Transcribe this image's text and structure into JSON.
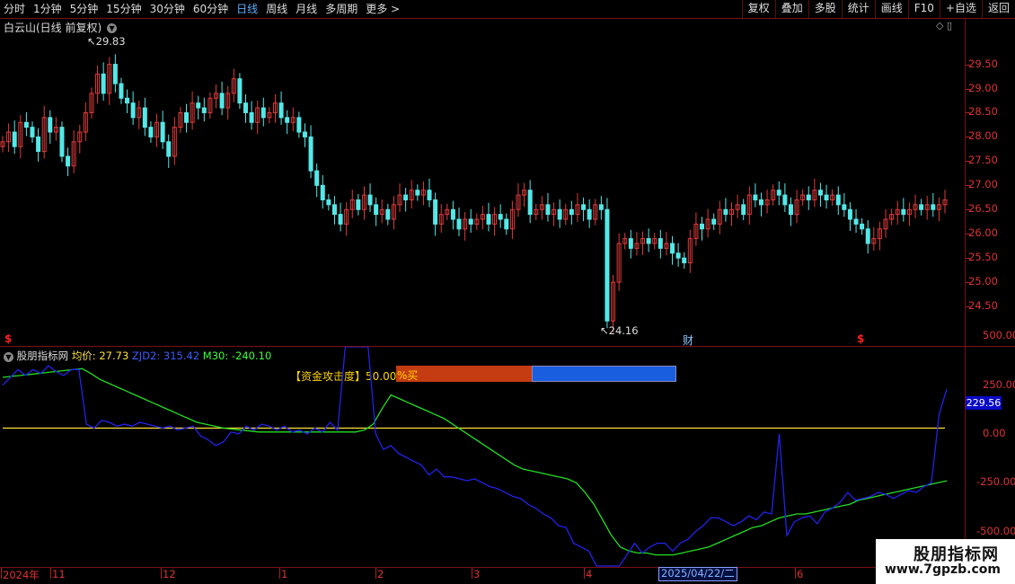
{
  "toolbar": {
    "periods": [
      "分时",
      "1分钟",
      "5分钟",
      "15分钟",
      "30分钟",
      "60分钟",
      "日线",
      "周线",
      "月线",
      "多周期",
      "更多 >"
    ],
    "active_period": "日线",
    "tools": [
      "复权",
      "叠加",
      "多股",
      "统计",
      "画线",
      "F10",
      "+自选",
      "返回"
    ]
  },
  "main_chart": {
    "title": "白云山(日线 前复权)",
    "high_label": "29.83",
    "low_label": "24.16",
    "price_ticks": [
      "29.50",
      "29.00",
      "28.50",
      "28.00",
      "27.50",
      "27.00",
      "26.50",
      "26.00",
      "25.50",
      "25.00",
      "24.50"
    ],
    "markers": {
      "s": "$",
      "cai": "财"
    }
  },
  "indicator": {
    "name": "股朋指标网",
    "avg_label": "均价: 27.73",
    "zjd_label": "ZJD2: 315.42",
    "m30_label": "M30: -240.10",
    "bar_label": "【资金攻击度】50.00",
    "bar_pct": "%买",
    "ticks": [
      "500.00",
      "250.00",
      "0.00",
      "-250.00",
      "-500.00"
    ],
    "current_value": "229.56"
  },
  "date_axis": {
    "labels": [
      "2024年",
      "11",
      "12",
      "1",
      "2",
      "3",
      "4",
      "6"
    ],
    "cursor_date": "2025/04/22/二"
  },
  "watermark": {
    "line1": "股朋指标网",
    "line2": "www.7gpzb.com"
  },
  "colors": {
    "up": "#e03a3a",
    "down": "#54e8e8",
    "zjd": "#2222ee",
    "m30": "#22dd22",
    "avg": "#ffe23a",
    "grid": "#7a1010"
  },
  "chart_data": [
    {
      "type": "candlestick",
      "title": "白云山(日线 前复权)",
      "ylim": [
        24.0,
        29.9
      ],
      "y_ticks": [
        24.5,
        25.0,
        25.5,
        26.0,
        26.5,
        27.0,
        27.5,
        28.0,
        28.5,
        29.0,
        29.5
      ],
      "high": 29.83,
      "low": 24.16,
      "close_series": [
        27.9,
        28.1,
        27.8,
        28.3,
        28.2,
        28.0,
        27.7,
        28.4,
        28.1,
        28.2,
        27.6,
        27.4,
        27.9,
        28.1,
        28.5,
        28.9,
        29.3,
        28.9,
        29.5,
        29.1,
        28.8,
        28.7,
        28.4,
        28.6,
        28.2,
        28.0,
        28.3,
        27.9,
        27.6,
        28.2,
        28.5,
        28.3,
        28.7,
        28.6,
        28.5,
        28.8,
        28.9,
        28.6,
        28.9,
        29.2,
        28.7,
        28.5,
        28.3,
        28.6,
        28.4,
        28.5,
        28.7,
        28.4,
        28.3,
        28.4,
        28.1,
        28.0,
        27.3,
        27.0,
        26.7,
        26.6,
        26.4,
        26.2,
        26.5,
        26.7,
        26.5,
        26.8,
        26.6,
        26.4,
        26.5,
        26.3,
        26.6,
        26.8,
        26.7,
        26.9,
        26.8,
        26.9,
        26.7,
        26.2,
        26.4,
        26.5,
        26.3,
        26.1,
        26.3,
        26.2,
        26.3,
        26.4,
        26.2,
        26.4,
        26.3,
        26.1,
        26.5,
        26.8,
        26.9,
        26.4,
        26.5,
        26.6,
        26.4,
        26.5,
        26.3,
        26.5,
        26.4,
        26.6,
        26.5,
        26.3,
        26.6,
        26.5,
        24.2,
        25.0,
        25.8,
        25.9,
        25.7,
        25.8,
        25.9,
        25.8,
        25.9,
        25.7,
        25.8,
        25.6,
        25.5,
        25.4,
        25.9,
        26.2,
        26.1,
        26.3,
        26.2,
        26.5,
        26.4,
        26.5,
        26.6,
        26.4,
        26.8,
        26.7,
        26.6,
        26.7,
        26.9,
        26.8,
        26.6,
        26.4,
        26.7,
        26.8,
        26.7,
        26.9,
        26.8,
        26.7,
        26.8,
        26.6,
        26.5,
        26.3,
        26.2,
        26.1,
        25.8,
        25.9,
        26.1,
        26.3,
        26.4,
        26.5,
        26.4,
        26.5,
        26.6,
        26.5,
        26.6,
        26.5,
        26.6,
        26.7
      ]
    },
    {
      "type": "line",
      "title": "股朋指标网",
      "ylim": [
        -800,
        750
      ],
      "y_ticks": [
        -500,
        -250,
        0,
        250,
        500
      ],
      "series": [
        {
          "name": "ZJD2",
          "color": "#2222ee",
          "values": [
            250,
            290,
            330,
            300,
            330,
            310,
            350,
            320,
            300,
            330,
            330,
            50,
            30,
            70,
            60,
            40,
            50,
            40,
            60,
            50,
            40,
            30,
            40,
            20,
            30,
            40,
            -10,
            -30,
            -60,
            -40,
            10,
            0,
            40,
            20,
            50,
            40,
            20,
            40,
            10,
            20,
            0,
            30,
            10,
            60,
            20,
            680,
            680,
            660,
            640,
            0,
            -80,
            -60,
            -100,
            -120,
            -140,
            -160,
            -210,
            -180,
            -220,
            -220,
            -230,
            -240,
            -230,
            -250,
            -270,
            -280,
            -300,
            -320,
            -330,
            -360,
            -380,
            -410,
            -430,
            -470,
            -480,
            -560,
            -580,
            -600,
            -1300,
            -1300,
            -1300,
            -1330,
            -620,
            -560,
            -610,
            -580,
            -560,
            -560,
            -600,
            -560,
            -540,
            -500,
            -470,
            -430,
            -430,
            -450,
            -470,
            -450,
            -420,
            -440,
            -400,
            -410,
            0,
            -520,
            -450,
            -430,
            -420,
            -460,
            -400,
            -380,
            -350,
            -300,
            -340,
            -330,
            -320,
            -300,
            -310,
            -330,
            -310,
            -290,
            -300,
            -270,
            -250,
            100,
            229.56
          ]
        },
        {
          "name": "M30",
          "color": "#22dd22",
          "values": [
            290,
            295,
            300,
            305,
            310,
            315,
            320,
            325,
            330,
            335,
            310,
            280,
            260,
            240,
            220,
            200,
            180,
            160,
            140,
            120,
            100,
            80,
            60,
            50,
            40,
            30,
            25,
            20,
            15,
            10,
            10,
            10,
            10,
            10,
            10,
            10,
            10,
            10,
            10,
            10,
            10,
            20,
            50,
            130,
            200,
            180,
            160,
            140,
            120,
            100,
            80,
            50,
            20,
            -10,
            -40,
            -70,
            -100,
            -130,
            -160,
            -180,
            -190,
            -200,
            -210,
            -220,
            -230,
            -250,
            -300,
            -360,
            -440,
            -520,
            -580,
            -600,
            -610,
            -610,
            -620,
            -620,
            -620,
            -610,
            -600,
            -590,
            -580,
            -560,
            -540,
            -520,
            -500,
            -480,
            -470,
            -450,
            -430,
            -420,
            -410,
            -410,
            -400,
            -390,
            -380,
            -370,
            -360,
            -340,
            -330,
            -320,
            -310,
            -300,
            -290,
            -280,
            -270,
            -260,
            -250,
            -240
          ]
        },
        {
          "name": "均价",
          "color": "#ffe23a",
          "values": [
            30,
            30
          ]
        }
      ]
    }
  ]
}
